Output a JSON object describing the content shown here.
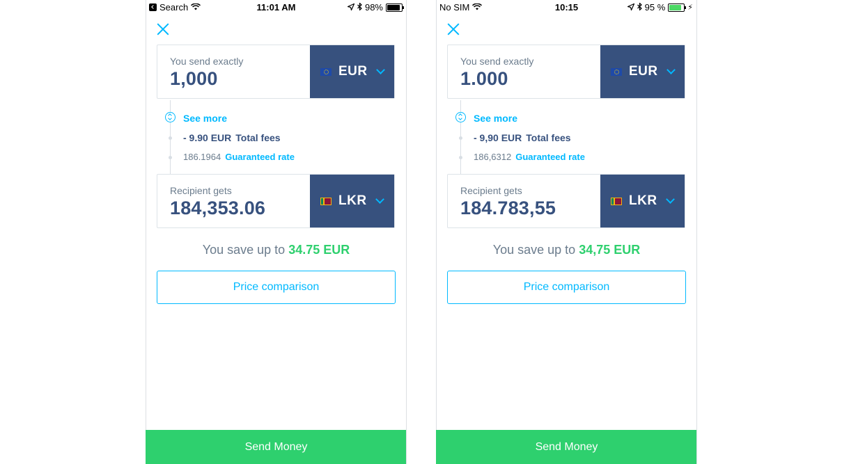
{
  "screens": [
    {
      "status": {
        "carrier": "Search",
        "time": "11:01 AM",
        "battery": "98%",
        "battery_level": 0.98
      },
      "send": {
        "label": "You send exactly",
        "amount": "1,000",
        "currency": "EUR"
      },
      "see_more": "See more",
      "fees": {
        "amount": "- 9.90 EUR",
        "label": "Total fees"
      },
      "rate": {
        "value": "186.1964",
        "label": "Guaranteed rate"
      },
      "receive": {
        "label": "Recipient gets",
        "amount": "184,353.06",
        "currency": "LKR"
      },
      "savings": {
        "prefix": "You save up to",
        "amount": "34.75 EUR"
      },
      "price_comparison": "Price comparison",
      "send_money": "Send Money"
    },
    {
      "status": {
        "carrier": "No SIM",
        "time": "10:15",
        "battery": "95 %",
        "battery_level": 0.95
      },
      "send": {
        "label": "You send exactly",
        "amount": "1.000",
        "currency": "EUR"
      },
      "see_more": "See more",
      "fees": {
        "amount": "- 9,90 EUR",
        "label": "Total fees"
      },
      "rate": {
        "value": "186,6312",
        "label": "Guaranteed rate"
      },
      "receive": {
        "label": "Recipient gets",
        "amount": "184.783,55",
        "currency": "LKR"
      },
      "savings": {
        "prefix": "You save up to",
        "amount": "34,75 EUR"
      },
      "price_comparison": "Price comparison",
      "send_money": "Send Money"
    }
  ],
  "icons": [
    "back-to-app-icon",
    "wifi-icon",
    "location-icon",
    "bluetooth-icon",
    "battery-icon",
    "charging-bolt-icon",
    "close-icon",
    "eu-flag-icon",
    "sri-lanka-flag-icon",
    "chevron-down-icon",
    "expand-icon"
  ],
  "colors": {
    "primary_navy": "#37517e",
    "accent_blue": "#00b9ff",
    "success_green": "#2ed06e",
    "muted_text": "#6b7c8d",
    "battery_green": "#4cd964"
  }
}
